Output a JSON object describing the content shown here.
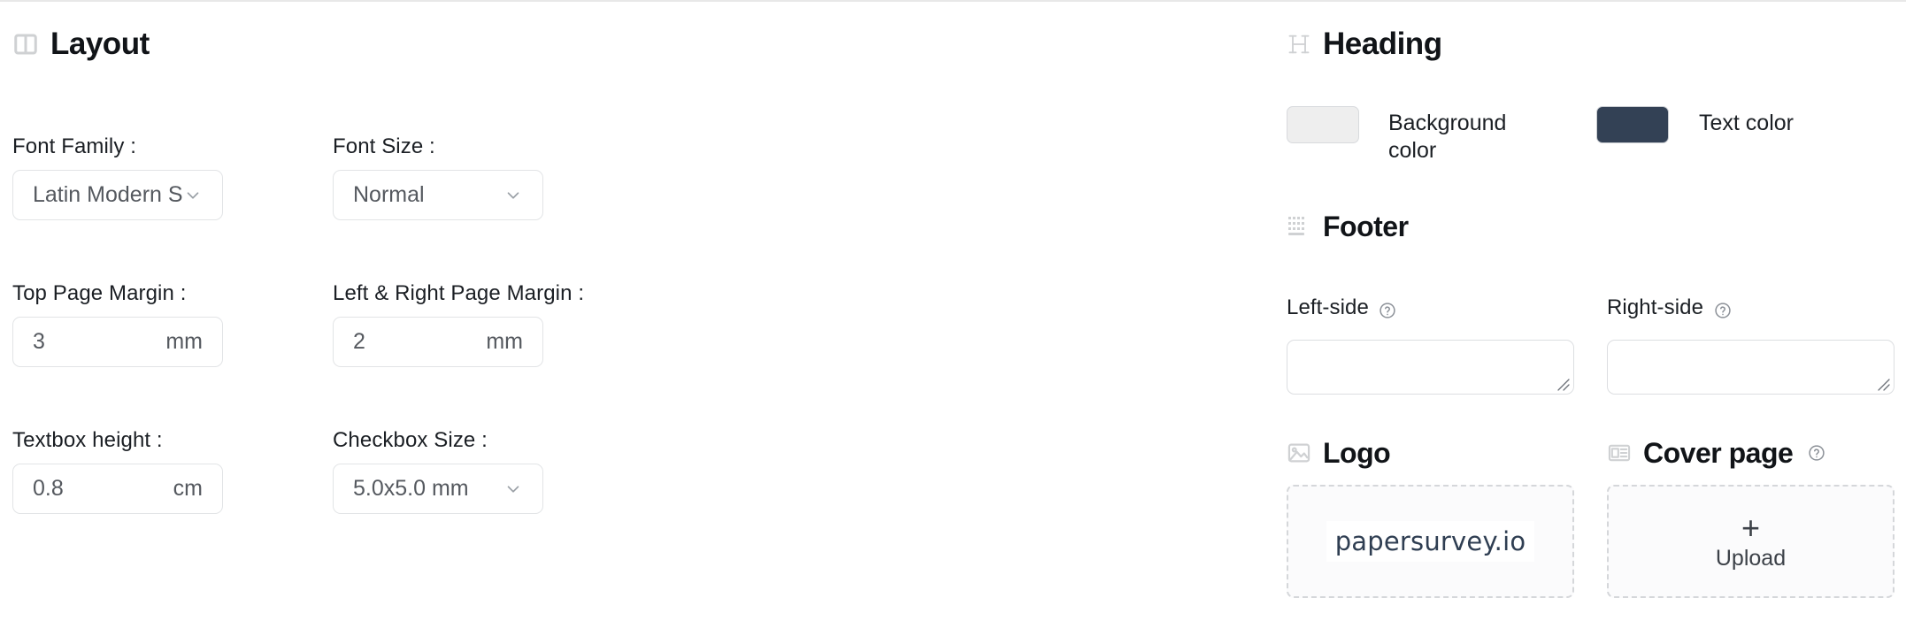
{
  "layout_section": {
    "icon": "columns-icon",
    "title": "Layout",
    "fields": {
      "font_family": {
        "label": "Font Family :",
        "value": "Latin Modern San...",
        "icon": "chevron-down-icon"
      },
      "font_size": {
        "label": "Font Size :",
        "value": "Normal",
        "icon": "chevron-down-icon"
      },
      "top_page_margin": {
        "label": "Top Page Margin :",
        "value": "3",
        "unit": "mm"
      },
      "left_right_page_margin": {
        "label": "Left & Right Page Margin :",
        "value": "2",
        "unit": "mm"
      },
      "textbox_height": {
        "label": "Textbox height :",
        "value": "0.8",
        "unit": "cm"
      },
      "checkbox_size": {
        "label": "Checkbox Size :",
        "value": "5.0x5.0 mm",
        "icon": "chevron-down-icon"
      }
    }
  },
  "heading_section": {
    "icon": "heading-h-icon",
    "title": "Heading",
    "background_color": {
      "label": "Background color",
      "swatch_hex": "#eeeeee"
    },
    "text_color": {
      "label": "Text color",
      "swatch_hex": "#334155"
    }
  },
  "footer_section": {
    "icon": "keyboard-grid-icon",
    "title": "Footer",
    "left_side": {
      "label": "Left-side",
      "help_icon": "help-circle-icon",
      "value": "",
      "placeholder": ""
    },
    "right_side": {
      "label": "Right-side",
      "help_icon": "help-circle-icon",
      "value": "",
      "placeholder": ""
    }
  },
  "logo_section": {
    "icon": "image-icon",
    "title": "Logo",
    "logo_text": "papersurvey.io"
  },
  "cover_page_section": {
    "icon": "newspaper-icon",
    "title": "Cover page",
    "help_icon": "help-circle-icon",
    "upload_label": "Upload",
    "plus_glyph": "+"
  }
}
